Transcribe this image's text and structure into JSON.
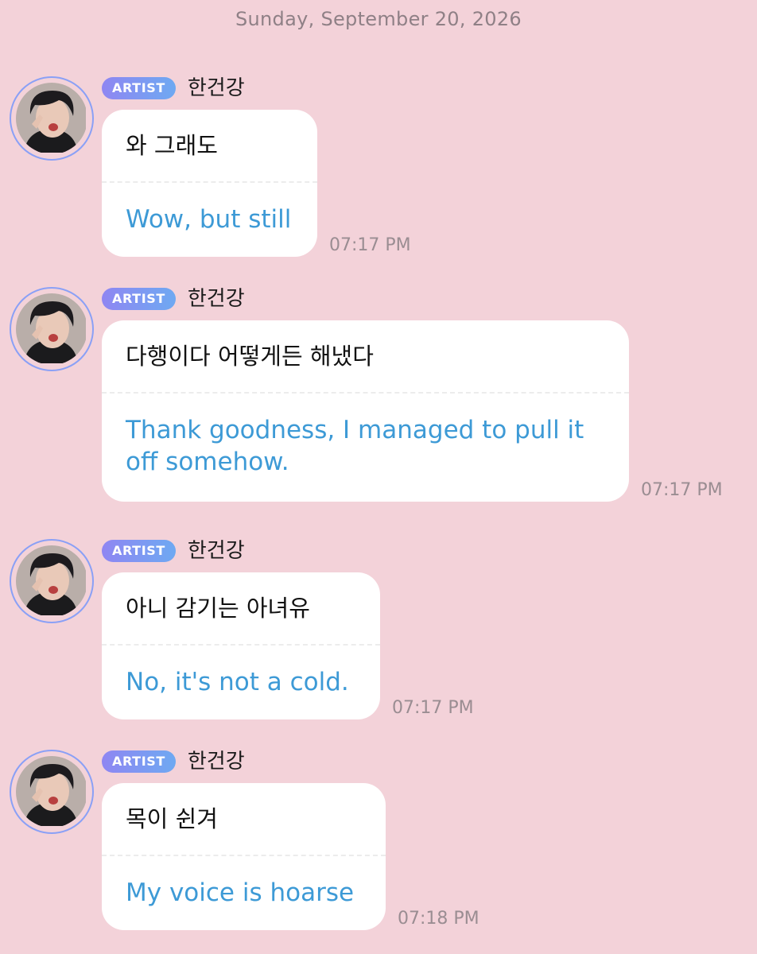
{
  "date_header": "Sunday, September 20, 2026",
  "messages": [
    {
      "badge": "ARTIST",
      "name": "한건강",
      "original": "와 그래도",
      "translation": "Wow, but still",
      "time": "07:17 PM"
    },
    {
      "badge": "ARTIST",
      "name": "한건강",
      "original": " 다행이다 어떻게든 해냈다",
      "translation": "Thank goodness, I managed to pull it off somehow.",
      "time": "07:17 PM"
    },
    {
      "badge": "ARTIST",
      "name": "한건강",
      "original": "아니 감기는 아녀유",
      "translation": "No, it's not a cold.",
      "time": "07:17 PM"
    },
    {
      "badge": "ARTIST",
      "name": "한건강",
      "original": "목이 쉰겨",
      "translation": "My voice is hoarse",
      "time": "07:18 PM"
    }
  ]
}
